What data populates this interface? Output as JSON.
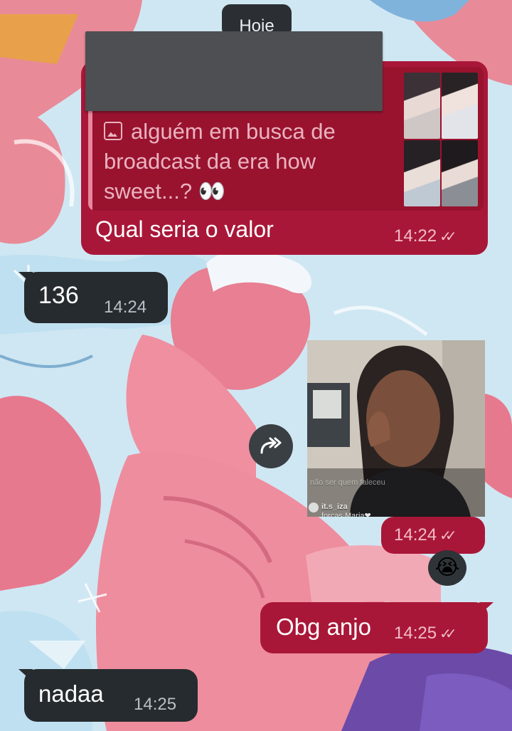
{
  "date_separator": "Hoje",
  "messages": {
    "reply": {
      "quoted_text": "alguém em busca de broadcast da era how sweet...? 👀",
      "body": "Qual seria o valor",
      "time": "14:22",
      "status_icon": "double-check-icon"
    },
    "incoming_1": {
      "body": "136",
      "time": "14:24"
    },
    "photo_message": {
      "time": "14:24",
      "status_icon": "double-check-icon",
      "photo_overlay": {
        "username": "it.s_iza",
        "comment": "forças Maria❤",
        "faded_text": "não ser quem faleceu"
      },
      "forward_icon": "forward-icon",
      "reaction": "😭"
    },
    "outgoing_thanks": {
      "body": "Obg anjo",
      "time": "14:25",
      "status_icon": "double-check-icon"
    },
    "incoming_2": {
      "body": "nadaa",
      "time": "14:25"
    }
  },
  "colors": {
    "outgoing_bubble": "#a91738",
    "incoming_bubble": "#262b2f",
    "date_pill": "#2b2f33"
  }
}
